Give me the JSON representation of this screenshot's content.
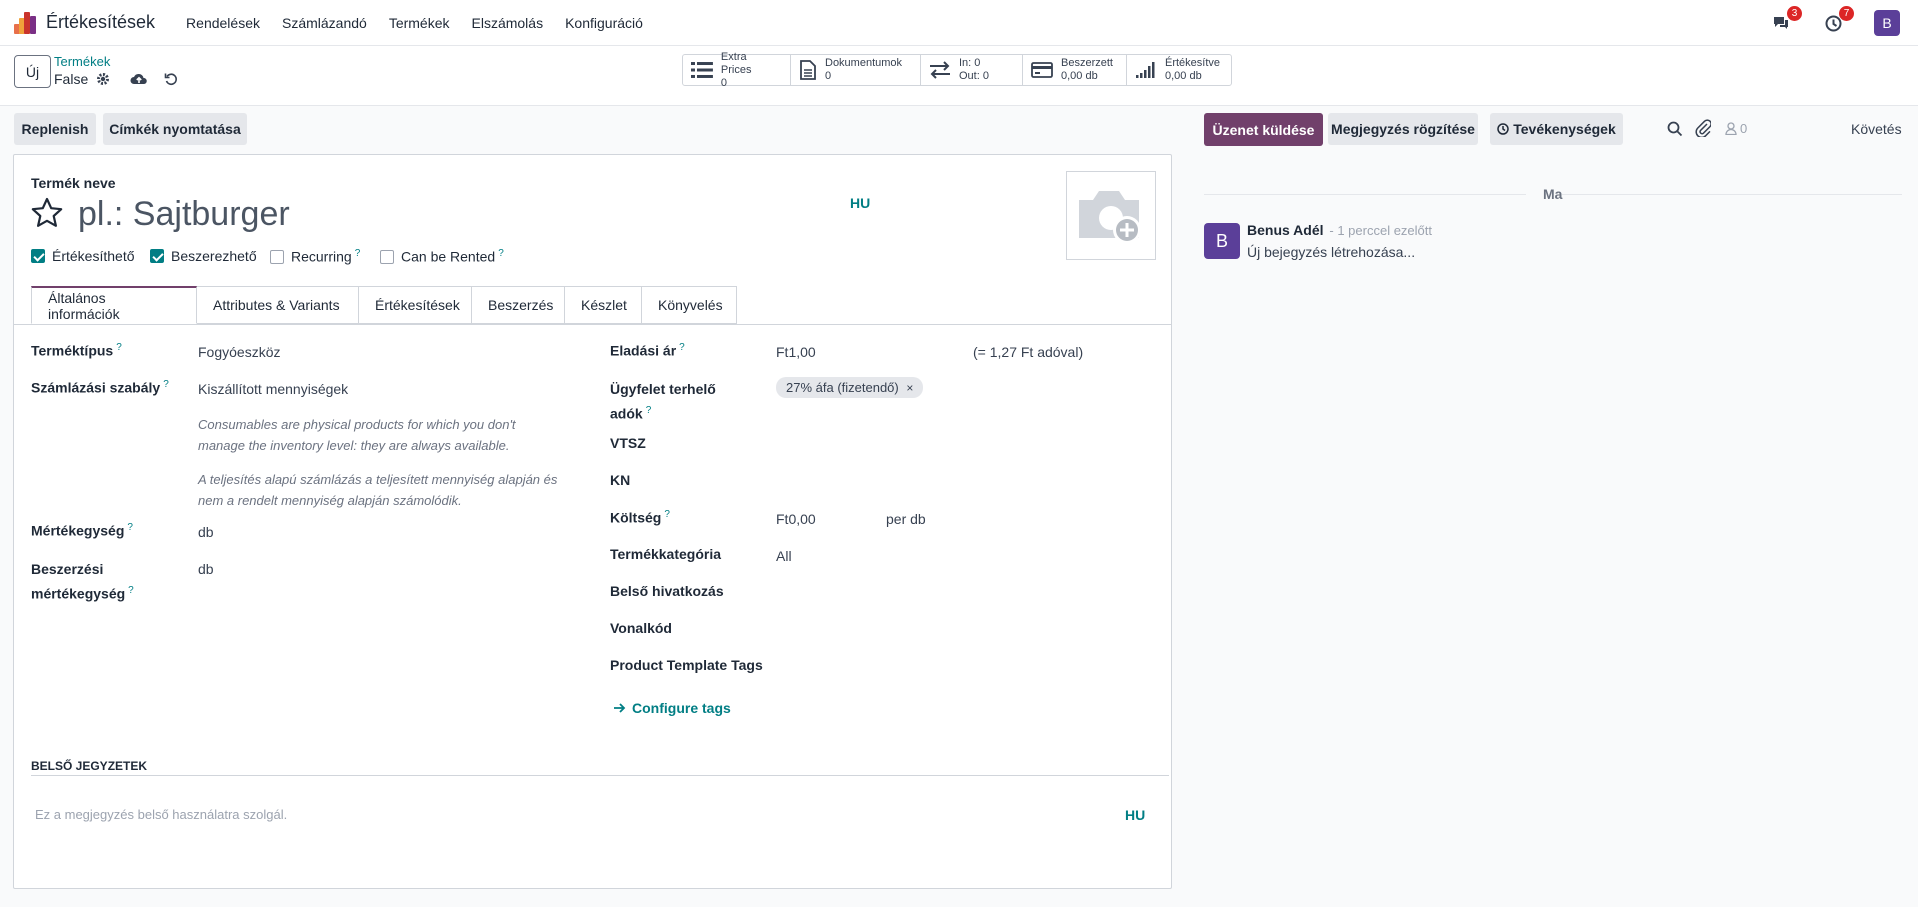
{
  "topnav": {
    "app_title": "Értékesítések",
    "menu": [
      "Rendelések",
      "Számlázandó",
      "Termékek",
      "Elszámolás",
      "Konfiguráció"
    ],
    "messages_count": "3",
    "activities_count": "7",
    "user_initial": "B",
    "brand_colors": [
      "#e8704a",
      "#f0a23a",
      "#c9342c",
      "#7a2f85"
    ]
  },
  "control_panel": {
    "new_label": "Új",
    "breadcrumb": "Termékek",
    "record_name": "False",
    "smart_buttons": [
      {
        "icon": "list-icon",
        "label": "Extra Prices",
        "value": "0"
      },
      {
        "icon": "document-icon",
        "label": "Dokumentumok",
        "value": "0"
      },
      {
        "icon": "transfer-icon",
        "label": "In: 0",
        "value": "Out: 0"
      },
      {
        "icon": "card-icon",
        "label": "Beszerzett",
        "value": "0,00 db"
      },
      {
        "icon": "signal-icon",
        "label": "Értékesítve",
        "value": "0,00 db"
      }
    ]
  },
  "actions": {
    "replenish": "Replenish",
    "print_labels": "Címkék nyomtatása"
  },
  "form": {
    "name_label": "Termék neve",
    "name_placeholder": "pl.: Sajtburger",
    "lang": "HU",
    "checkboxes": [
      {
        "label": "Értékesíthető",
        "checked": true,
        "help": false
      },
      {
        "label": "Beszerezhető",
        "checked": true,
        "help": false
      },
      {
        "label": "Recurring",
        "checked": false,
        "help": true
      },
      {
        "label": "Can be Rented",
        "checked": false,
        "help": true
      }
    ],
    "tabs": [
      "Általános információk",
      "Attributes & Variants",
      "Értékesítések",
      "Beszerzés",
      "Készlet",
      "Könyvelés"
    ],
    "left": {
      "type_label": "Terméktípus",
      "type_value": "Fogyóeszköz",
      "invoice_policy_label": "Számlázási szabály",
      "invoice_policy_value": "Kiszállított mennyiségek",
      "help1_line1": "Consumables are physical products for which you don't",
      "help1_line2": "manage the inventory level: they are always available.",
      "help2_line1": "A teljesítés alapú számlázás a teljesített mennyiség alapján és",
      "help2_line2": "nem a rendelt mennyiség alapján számolódik.",
      "uom_label": "Mértékegység",
      "uom_value": "db",
      "purchase_uom_label1": "Beszerzési",
      "purchase_uom_label2": "mértékegység",
      "purchase_uom_value": "db"
    },
    "right": {
      "price_label": "Eladási ár",
      "price_value": "Ft1,00",
      "price_tax": "(= 1,27 Ft adóval)",
      "taxes_label1": "Ügyfelet terhelő",
      "taxes_label2": "adók",
      "tax_tag": "27% áfa (fizetendő)",
      "vtsz_label": "VTSZ",
      "kn_label": "KN",
      "cost_label": "Költség",
      "cost_value": "Ft0,00",
      "cost_unit": "per db",
      "category_label": "Termékkategória",
      "category_value": "All",
      "internal_ref_label": "Belső hivatkozás",
      "barcode_label": "Vonalkód",
      "tags_label": "Product Template Tags",
      "configure_tags": "Configure tags"
    },
    "notes_title": "BELSŐ JEGYZETEK",
    "notes_placeholder": "Ez a megjegyzés belső használatra szolgál.",
    "notes_lang": "HU"
  },
  "chatter": {
    "send_message": "Üzenet küldése",
    "log_note": "Megjegyzés rögzítése",
    "activities": "Tevékenységek",
    "followers_count": "0",
    "follow": "Követés",
    "date_separator": "Ma",
    "author": "Benus Adél",
    "time": "- 1 perccel ezelőtt",
    "message": "Új bejegyzés létrehozása...",
    "author_initial": "B"
  },
  "colors": {
    "primary": "#71406b",
    "link": "#017e84",
    "badge": "#dc2626",
    "avatar": "#5b3f99"
  }
}
